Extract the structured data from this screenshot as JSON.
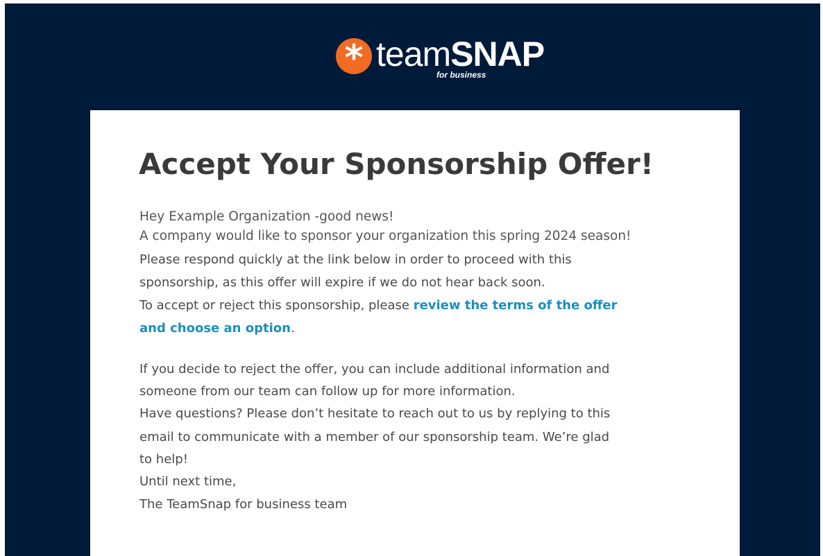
{
  "header": {
    "logo_word_1": "team",
    "logo_word_2": "SNAP",
    "logo_tagline": "for business"
  },
  "email": {
    "title": "Accept Your Sponsorship Offer!",
    "greeting": "Hey Example Organization -good news!",
    "line_sponsor": "A company would like to sponsor your organization this spring 2024 season!",
    "line_respond_1": "Please respond quickly at the link below in order to proceed with this",
    "line_respond_2": "sponsorship, as this offer will expire if we do not hear back soon.",
    "line_accept_prefix": "To accept or reject this sponsorship, please ",
    "link_text_1": "review the terms of the offer",
    "link_text_2": "and choose an option",
    "link_suffix": ".",
    "line_reject_1": "If you decide to reject the offer, you can include additional information and",
    "line_reject_2": "someone from our team can follow up for more information.",
    "line_questions_1": "Have questions? Please don’t hesitate to reach out to us by replying to this",
    "line_questions_2": "email to communicate with a member of our sponsorship team. We’re glad",
    "line_questions_3": "to help!",
    "signoff": "Until next time,",
    "signature": "The TeamSnap for business team"
  },
  "colors": {
    "header_background": "#001a3a",
    "logo_orange": "#f26b22",
    "link": "#1a8fbf"
  },
  "icons": {
    "logo_badge": "asterisk-icon"
  }
}
